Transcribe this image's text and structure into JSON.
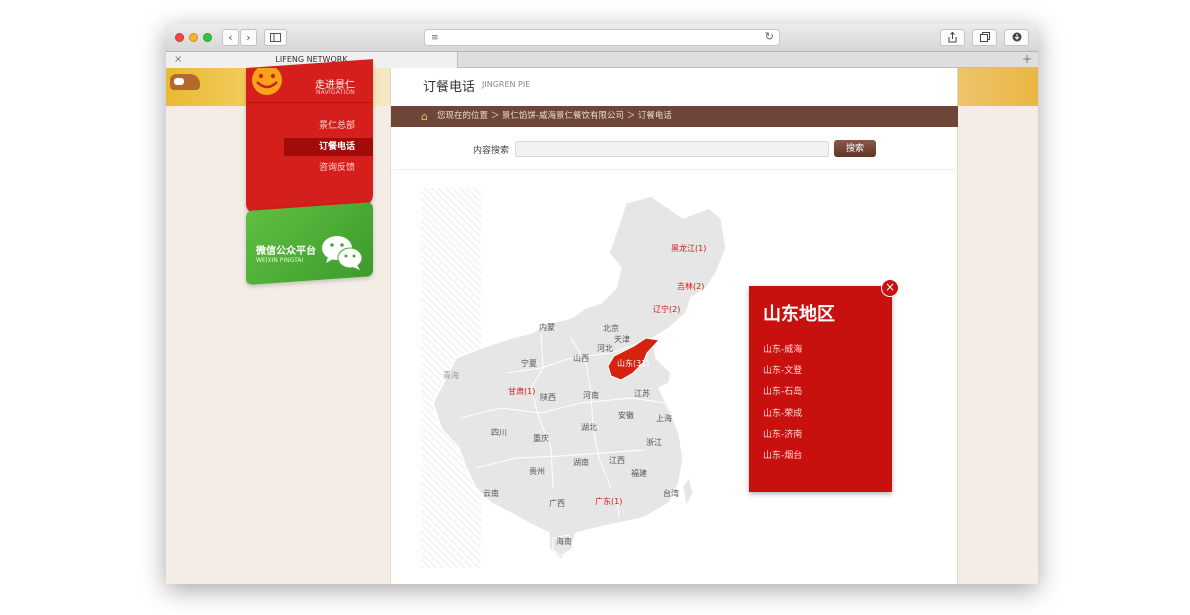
{
  "browser": {
    "tab_title": "LIFENG NETWORK",
    "back": "‹",
    "forward": "›"
  },
  "sidebar": {
    "title": "走进景仁",
    "subtitle": "NAVIGATION",
    "items": [
      {
        "label": "景仁总部"
      },
      {
        "label": "订餐电话"
      },
      {
        "label": "咨询反馈"
      }
    ]
  },
  "wechat": {
    "title": "微信公众平台",
    "subtitle": "WEIXIN PINGTAI"
  },
  "header": {
    "title": "订餐电话",
    "subtitle": "JINGREN PIE"
  },
  "breadcrumb": {
    "text": "您现在的位置 ＞ 景仁馅饼-威海景仁餐饮有限公司 ＞ 订餐电话"
  },
  "search": {
    "label": "内容搜索",
    "value": "",
    "button": "搜索"
  },
  "map": {
    "provinces": [
      {
        "name": "黑龙江(1)",
        "highlight": true
      },
      {
        "name": "吉林(2)",
        "highlight": true
      },
      {
        "name": "辽宁(2)",
        "highlight": true
      },
      {
        "name": "内蒙",
        "highlight": false
      },
      {
        "name": "北京",
        "highlight": false
      },
      {
        "name": "天津",
        "highlight": false
      },
      {
        "name": "河北",
        "highlight": false
      },
      {
        "name": "山西",
        "highlight": false
      },
      {
        "name": "山东(31)",
        "highlight": true
      },
      {
        "name": "宁夏",
        "highlight": false
      },
      {
        "name": "青海",
        "highlight": false
      },
      {
        "name": "甘肃(1)",
        "highlight": true
      },
      {
        "name": "陕西",
        "highlight": false
      },
      {
        "name": "河南",
        "highlight": false
      },
      {
        "name": "江苏",
        "highlight": false
      },
      {
        "name": "安徽",
        "highlight": false
      },
      {
        "name": "上海",
        "highlight": false
      },
      {
        "name": "四川",
        "highlight": false
      },
      {
        "name": "重庆",
        "highlight": false
      },
      {
        "name": "湖北",
        "highlight": false
      },
      {
        "name": "浙江",
        "highlight": false
      },
      {
        "name": "贵州",
        "highlight": false
      },
      {
        "name": "湖南",
        "highlight": false
      },
      {
        "name": "江西",
        "highlight": false
      },
      {
        "name": "福建",
        "highlight": false
      },
      {
        "name": "云南",
        "highlight": false
      },
      {
        "name": "广西",
        "highlight": false
      },
      {
        "name": "广东(1)",
        "highlight": true
      },
      {
        "name": "台湾",
        "highlight": false
      },
      {
        "name": "海南",
        "highlight": false
      }
    ],
    "selected_color": "#d6230f",
    "base_color": "#e6e6e6"
  },
  "popup": {
    "title": "山东地区",
    "items": [
      "山东-威海",
      "山东-文登",
      "山东-石岛",
      "山东-荣成",
      "山东-济南",
      "山东-烟台"
    ],
    "close": "×"
  }
}
